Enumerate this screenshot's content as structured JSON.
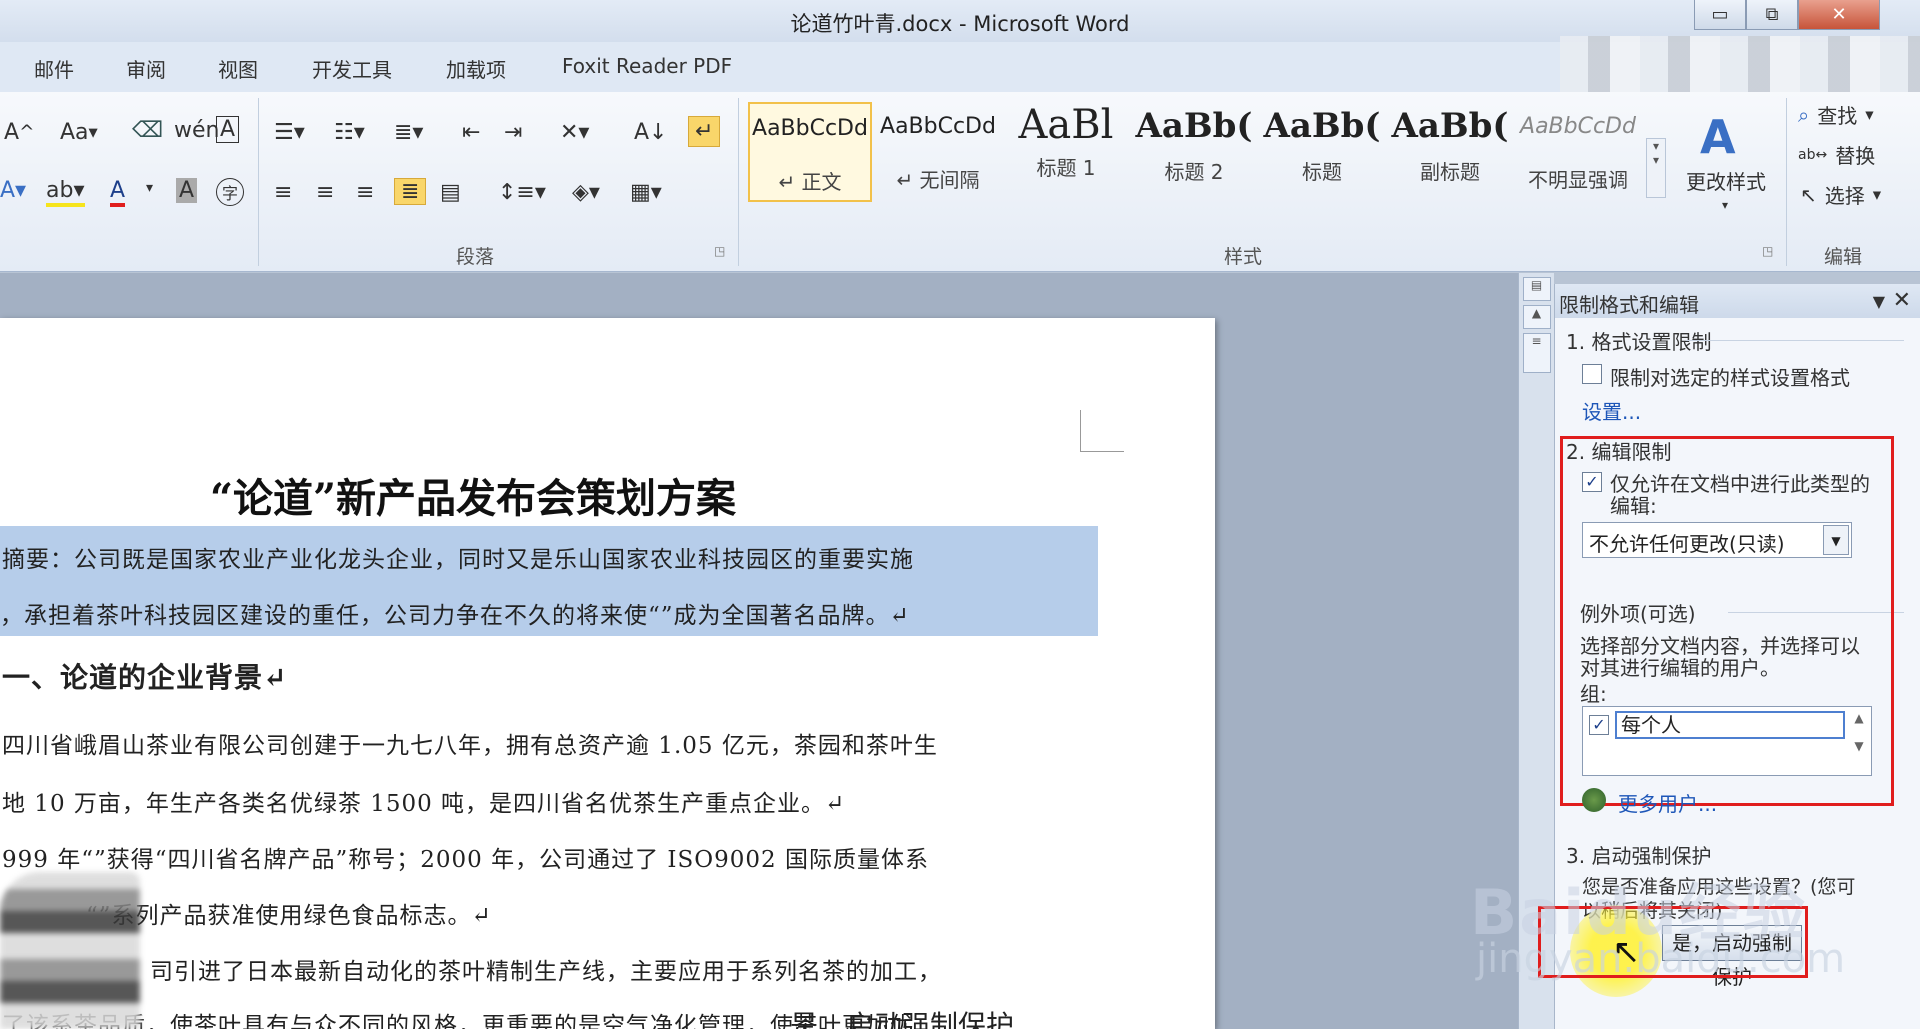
{
  "window": {
    "title": "论道竹叶青.docx - Microsoft Word",
    "minimize": "▭",
    "restore": "⧉",
    "close": "✕"
  },
  "tabs": [
    "邮件",
    "审阅",
    "视图",
    "开发工具",
    "加载项",
    "Foxit Reader PDF"
  ],
  "ribbon": {
    "font_tools": {
      "font_size_grow": "A",
      "change_case": "Aa",
      "font_color": "A",
      "char_shade": "A",
      "enclose": "字"
    },
    "paragraph": {
      "label": "段落",
      "sort": "A↓"
    },
    "styles": {
      "label": "样式",
      "items": [
        {
          "preview": "AaBbCcDd",
          "name": "↵ 正文",
          "selected": true
        },
        {
          "preview": "AaBbCcDd",
          "name": "↵ 无间隔",
          "selected": false
        },
        {
          "preview": "AaBl",
          "name": "标题 1",
          "selected": false
        },
        {
          "preview": "AaBb(",
          "name": "标题 2",
          "selected": false
        },
        {
          "preview": "AaBb(",
          "name": "标题",
          "selected": false
        },
        {
          "preview": "AaBb(",
          "name": "副标题",
          "selected": false
        },
        {
          "preview": "AaBbCcDd",
          "name": "不明显强调",
          "selected": false
        }
      ],
      "change_styles": "更改样式"
    },
    "editing": {
      "label": "编辑",
      "find": "查找",
      "replace": "替换",
      "select": "选择"
    }
  },
  "document": {
    "title": "“论道”新产品发布会策划方案",
    "lines": [
      "摘要：公司既是国家农业产业化龙头企业，同时又是乐山国家农业科技园区的重要实施",
      "，承担着茶叶科技园区建设的重任，公司力争在不久的将来使“”成为全国著名品牌。↵",
      "一、论道的企业背景↵",
      "四川省峨眉山茶业有限公司创建于一九七八年，拥有总资产逾 1.05 亿元，茶园和茶叶生",
      "地 10 万亩，年生产各类名优绿茶 1500 吨，是四川省名优茶生产重点企业。↵",
      "999 年“”获得“四川省名牌产品”称号；2000 年，公司通过了 ISO9002 国际质量体系",
      "“”系列产品获准使用绿色食品标志。↵",
      "司引进了日本最新自动化的茶叶精制生产线，主要应用于系列名茶的加工，",
      "了该系茶品质，使茶叶具有与众不同的风格，更重要的是空气净化管理，使茶叶更加优"
    ]
  },
  "pane": {
    "title": "限制格式和编辑",
    "section1": "1. 格式设置限制",
    "format_limit_checkbox": "限制对选定的样式设置格式",
    "format_limit_checked": false,
    "settings_link": "设置...",
    "section2": "2. 编辑限制",
    "edit_limit_checkbox_line1": "仅允许在文档中进行此类型的",
    "edit_limit_checkbox_line2": "编辑:",
    "edit_limit_checked": true,
    "edit_type_value": "不允许任何更改(只读)",
    "exceptions_label": "例外项(可选)",
    "exceptions_desc_line1": "选择部分文档内容，并选择可以",
    "exceptions_desc_line2": "对其进行编辑的用户。",
    "groups_label": "组:",
    "group_everyone": "每个人",
    "group_everyone_checked": true,
    "more_users_link": "更多用户...",
    "section3": "3. 启动强制保护",
    "apply_question": "您是否准备应用这些设置？(您可",
    "apply_question_line2": "以稍后将其关闭)",
    "start_button": "是，启动强制保护"
  },
  "watermark": {
    "brand": "Baidu经验",
    "url": "jingyan.baidu.com"
  },
  "bottom_text": "是，启动强制保护"
}
